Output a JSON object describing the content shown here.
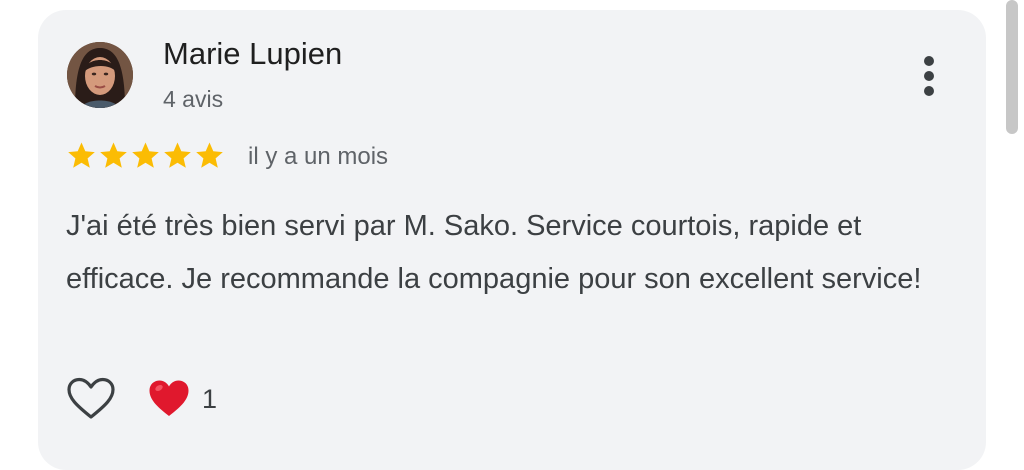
{
  "review": {
    "author_name": "Marie Lupien",
    "review_count": "4 avis",
    "rating": 5,
    "max_rating": 5,
    "date": "il y a un mois",
    "text": "J'ai été très bien servi par M. Sako. Service courtois, rapide et efficace. Je recommande la compagnie pour son excellent service!",
    "reaction_count": "1"
  },
  "icons": {
    "avatar": "profile-photo",
    "more": "three-dots-vertical-icon",
    "star": "star-filled-icon",
    "like": "heart-outline-icon",
    "reaction": "red-heart-emoji-icon"
  },
  "colors": {
    "card_background": "#f2f3f5",
    "star": "#fbbc04",
    "reaction_heart": "#e0182d",
    "secondary_text": "#5f6368"
  }
}
